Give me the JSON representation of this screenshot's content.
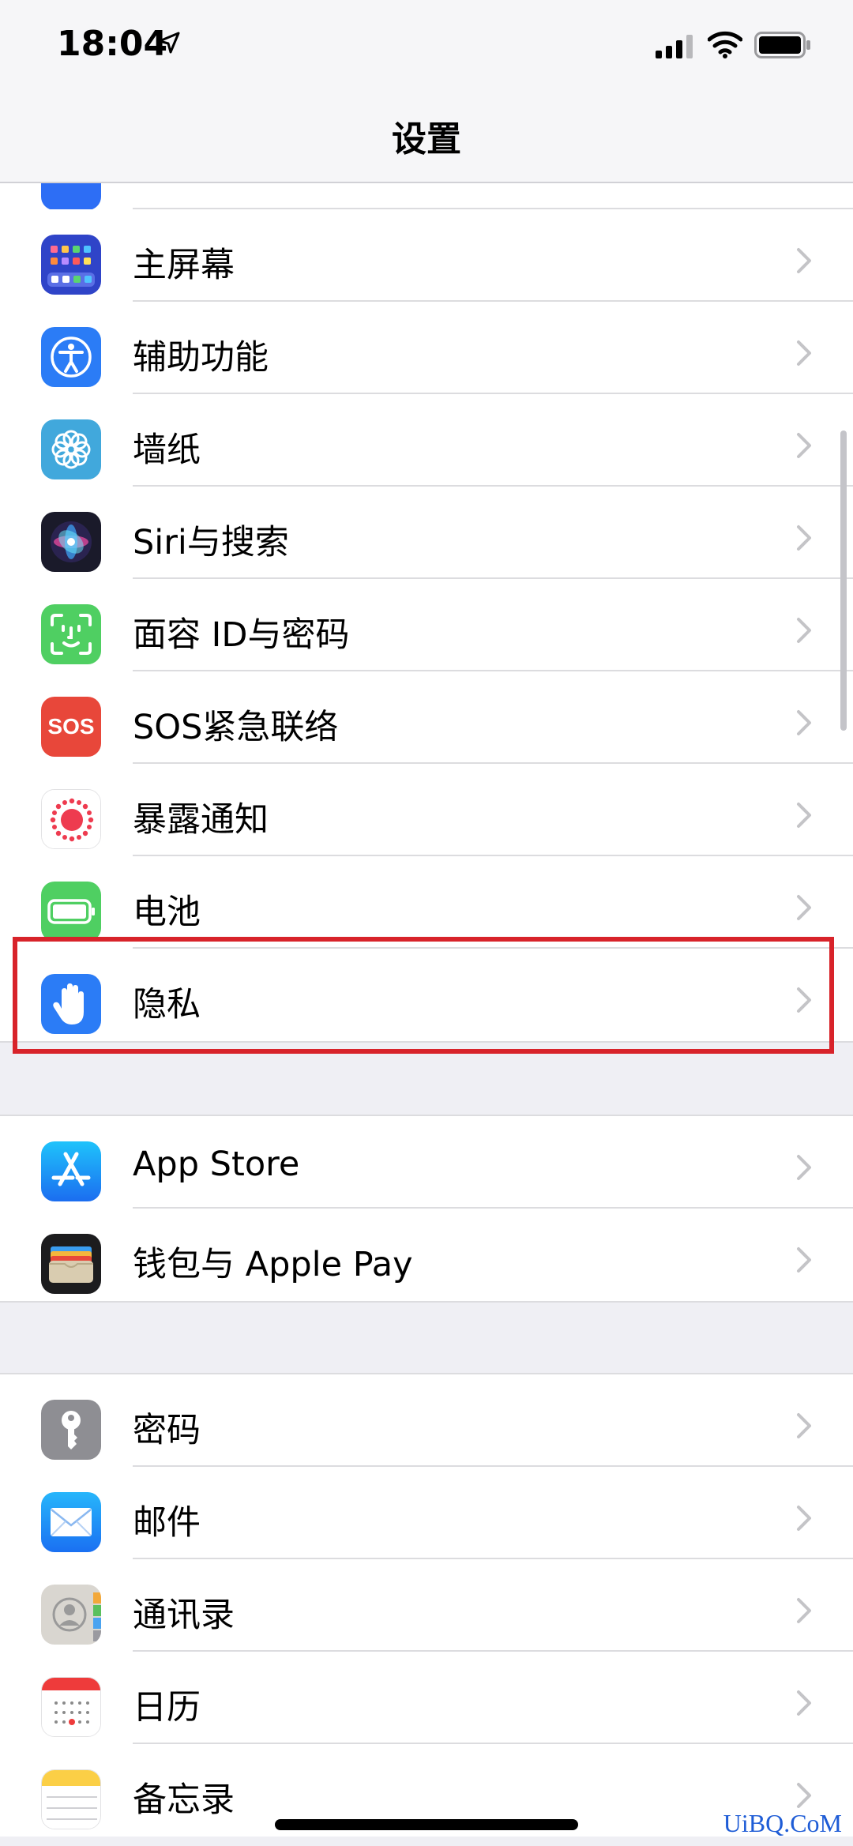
{
  "status_bar": {
    "time": "18:04"
  },
  "nav": {
    "title": "设置"
  },
  "groups": [
    {
      "items": [
        {
          "label": "主屏幕",
          "icon": "home-screen-icon"
        },
        {
          "label": "辅助功能",
          "icon": "accessibility-icon"
        },
        {
          "label": "墙纸",
          "icon": "wallpaper-icon"
        },
        {
          "label": "Siri与搜索",
          "icon": "siri-icon"
        },
        {
          "label": "面容 ID与密码",
          "icon": "face-id-icon"
        },
        {
          "label": "SOS紧急联络",
          "icon": "sos-icon",
          "icon_text": "SOS"
        },
        {
          "label": "暴露通知",
          "icon": "exposure-notification-icon"
        },
        {
          "label": "电池",
          "icon": "battery-icon"
        },
        {
          "label": "隐私",
          "icon": "privacy-hand-icon",
          "highlighted": true
        }
      ]
    },
    {
      "items": [
        {
          "label": "App Store",
          "icon": "app-store-icon"
        },
        {
          "label": "钱包与 Apple Pay",
          "icon": "wallet-icon"
        }
      ]
    },
    {
      "items": [
        {
          "label": "密码",
          "icon": "key-icon"
        },
        {
          "label": "邮件",
          "icon": "mail-icon"
        },
        {
          "label": "通讯录",
          "icon": "contacts-icon"
        },
        {
          "label": "日历",
          "icon": "calendar-icon"
        },
        {
          "label": "备忘录",
          "icon": "notes-icon"
        }
      ]
    }
  ],
  "watermark": "UiBQ.CoM",
  "colors": {
    "highlight": "#d8232a",
    "chevron": "#c4c4c7",
    "separator": "#dcdcdf"
  }
}
